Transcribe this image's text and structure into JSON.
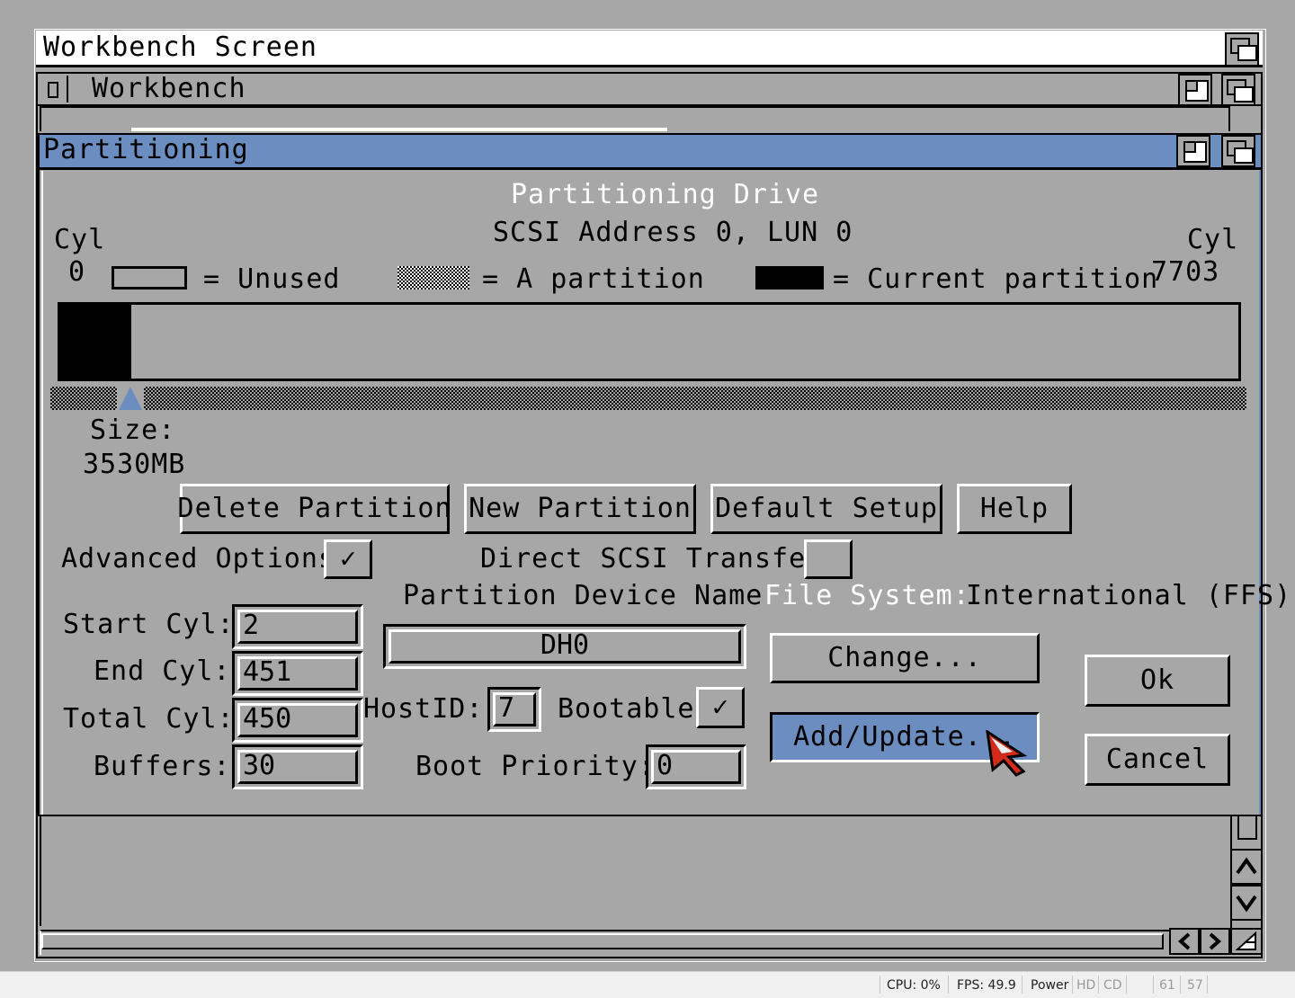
{
  "screen": {
    "title": "Workbench Screen"
  },
  "workbench_window": {
    "title": "Workbench"
  },
  "partitioning_window": {
    "title": "Partitioning",
    "heading": "Partitioning Drive",
    "scsi_address": "SCSI Address 0, LUN 0",
    "cyl_left_label": "Cyl",
    "cyl_left_value": "0",
    "cyl_right_label": "Cyl",
    "cyl_right_value": "7703",
    "legend": {
      "unused": "= Unused",
      "a_partition": "= A partition",
      "current_partition": "= Current partition"
    },
    "current_partition_fraction": 0.06,
    "size_label": "Size:",
    "size_value": "3530MB",
    "buttons": {
      "delete_partition": "Delete Partition",
      "new_partition": "New Partition",
      "default_setup": "Default Setup",
      "help": "Help",
      "change": "Change...",
      "add_update": "Add/Update...",
      "ok": "Ok",
      "cancel": "Cancel"
    },
    "advanced_options_label": "Advanced Options",
    "advanced_options_checked": true,
    "direct_scsi_label": "Direct SCSI Transfer",
    "direct_scsi_checked": false,
    "device_name_label": "Partition Device Name",
    "device_name_value": "DH0",
    "file_system_label": "File System:",
    "file_system_value": "International (FFS)",
    "start_cyl_label": "Start Cyl:",
    "start_cyl_value": "2",
    "end_cyl_label": "End Cyl:",
    "end_cyl_value": "451",
    "total_cyl_label": "Total Cyl:",
    "total_cyl_value": "450",
    "buffers_label": "Buffers:",
    "buffers_value": "30",
    "host_id_label": "HostID:",
    "host_id_value": "7",
    "bootable_label": "Bootable",
    "bootable_checked": true,
    "boot_priority_label": "Boot Priority:",
    "boot_priority_value": "0",
    "checkmark": "✓"
  },
  "statusbar": {
    "cpu": "CPU: 0%",
    "fps": "FPS: 49.9",
    "power": "Power",
    "hd": "HD",
    "cd": "CD",
    "n1": "61",
    "n2": "57"
  },
  "colors": {
    "background": "#a7a7a7",
    "accent_blue": "#6b8dc0",
    "pointer_red": "#d42a1c"
  }
}
